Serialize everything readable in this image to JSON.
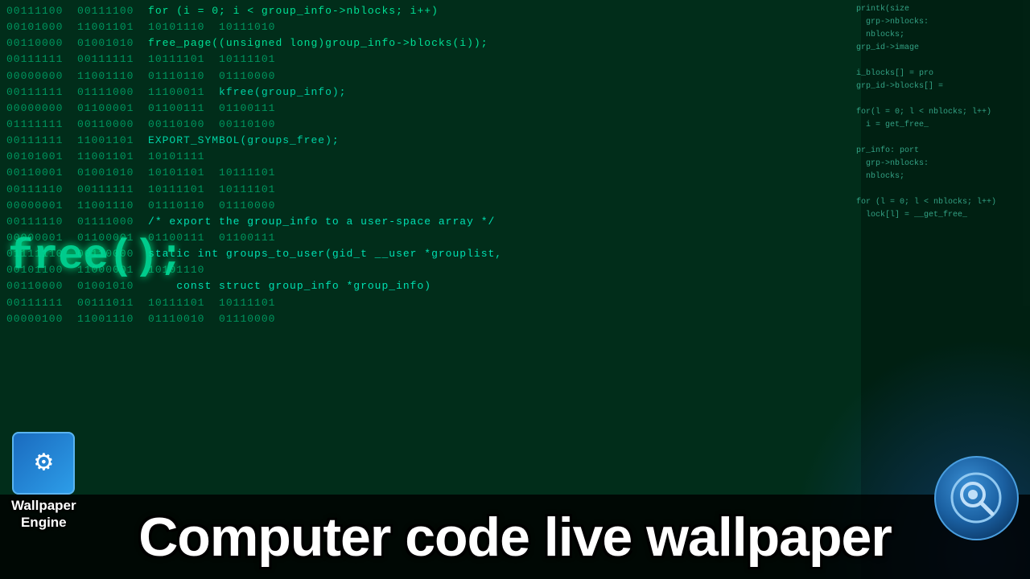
{
  "background": {
    "color": "#012d1a"
  },
  "code_lines": {
    "main_binary": "00111100  00111100  01001111  01001111\n00101000  11001101  10101110  10111010\n00110000  01001010  10101101  10111101\n00111111  00111111  10111101  10111101\n00000000  11001110  01110110  01110000\n00111111  01111000  11100011  11100001\n00000000  01100001  01100111  01100111\n01111111  00110000  00110100  00110100\n",
    "code_text_lines": [
      "for (i = 0; i < group_info->nblocks; i++)",
      "    free_page((unsigned long)group_info->blocks(i));",
      "",
      "    kfree(group_info);",
      "",
      "EXPORT_SYMBOL(groups_free);",
      "",
      "/* export the group_info to a user-space array */",
      "static int groups_to_user(gid_t __user *grouplist,",
      "    const struct group_info *group_info)"
    ]
  },
  "large_code": "free();",
  "bottom_title": "Computer code live wallpaper",
  "wallpaper_engine": {
    "label_line1": "Wallpaper",
    "label_line2": "Engine"
  },
  "steam": {
    "label": "Steam"
  }
}
